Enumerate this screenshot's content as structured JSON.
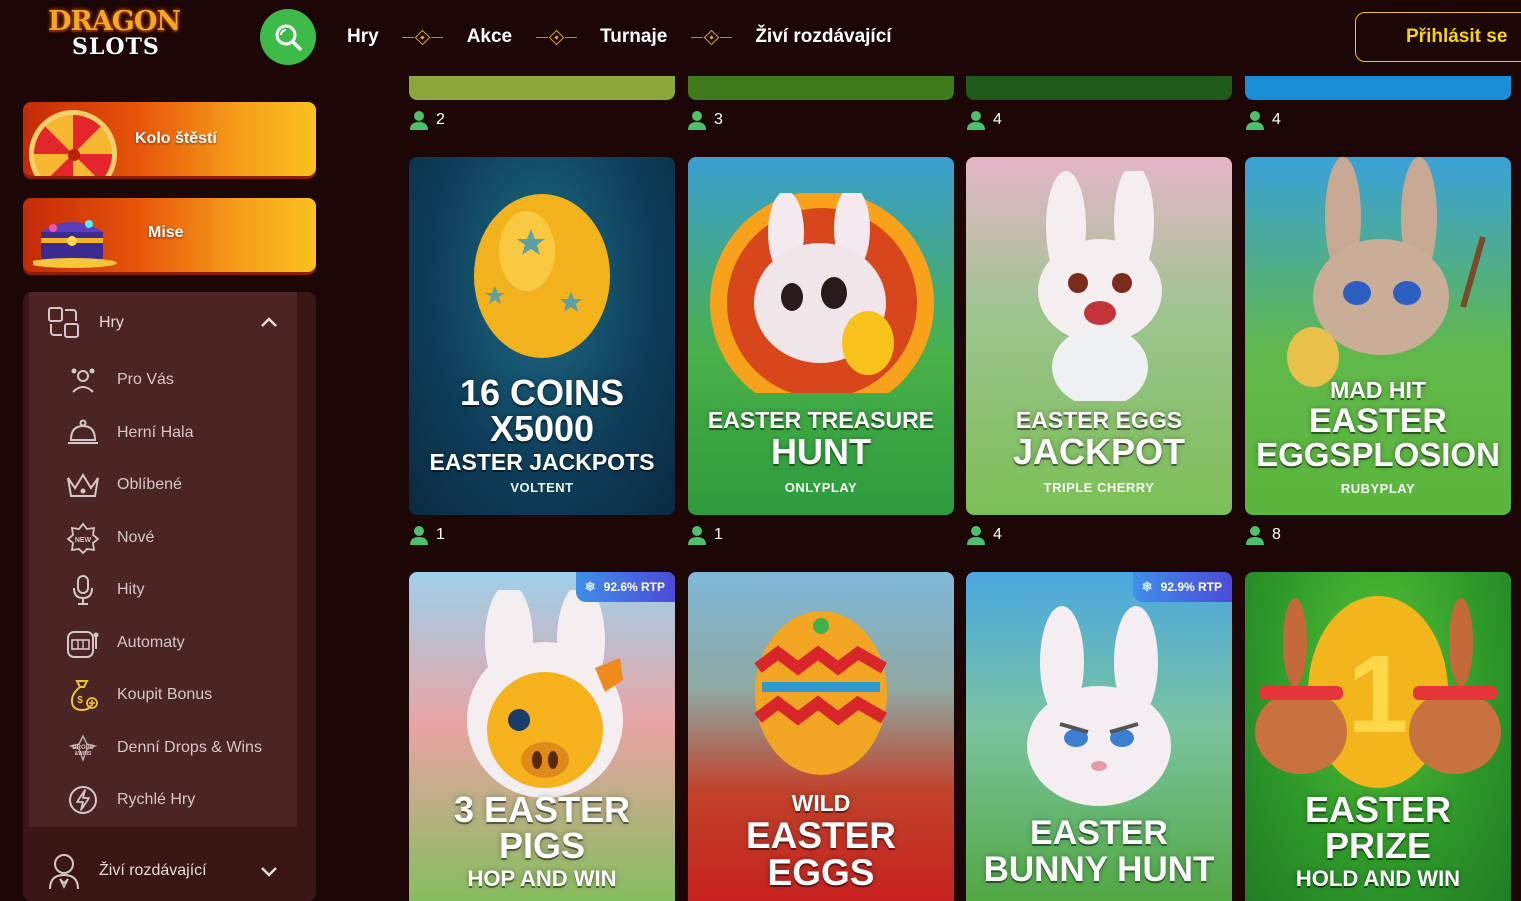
{
  "header": {
    "logo": {
      "line1": "DRAGON",
      "line2": "SLOTS"
    },
    "nav": [
      "Hry",
      "Akce",
      "Turnaje",
      "Živí rozdávající"
    ],
    "login_label": "Přihlásit se"
  },
  "sidebar": {
    "promos": [
      {
        "label": "Kolo štěstí"
      },
      {
        "label": "Mise"
      }
    ],
    "games_header": "Hry",
    "items": [
      {
        "label": "Pro Vás",
        "icon": "tools-icon"
      },
      {
        "label": "Herní Hala",
        "icon": "bell-icon"
      },
      {
        "label": "Oblíbené",
        "icon": "crown-icon"
      },
      {
        "label": "Nové",
        "icon": "new-badge-icon"
      },
      {
        "label": "Hity",
        "icon": "microphone-icon"
      },
      {
        "label": "Automaty",
        "icon": "slot-machine-icon"
      },
      {
        "label": "Koupit Bonus",
        "icon": "money-bag-icon"
      },
      {
        "label": "Denní Drops & Wins",
        "icon": "drops-wins-icon"
      },
      {
        "label": "Rychlé Hry",
        "icon": "lightning-icon"
      }
    ],
    "live_header": "Živí rozdávající"
  },
  "top_row_players": [
    "2",
    "3",
    "4",
    "4"
  ],
  "top_row_colors": [
    "#8ba63a",
    "#3f7a1a",
    "#1f5a1a",
    "#1a8fd8"
  ],
  "games_row1": [
    {
      "title_lines": [
        "16 COINS",
        "X5000"
      ],
      "subtitle": "EASTER JACKPOTS",
      "provider": "VOLTENT",
      "players": "1"
    },
    {
      "title_lines": [
        "EASTER TREASURE",
        "HUNT"
      ],
      "provider": "ONLYPLAY",
      "players": "1"
    },
    {
      "title_lines": [
        "EASTER EGGS",
        "JACKPOT"
      ],
      "provider": "TRIPLE CHERRY",
      "players": "4"
    },
    {
      "title_lines": [
        "MAD HIT",
        "EASTER",
        "EGGSPLOSION"
      ],
      "provider": "RUBYPLAY",
      "players": "8"
    }
  ],
  "games_row2": [
    {
      "title_lines": [
        "3 EASTER",
        "PIGS"
      ],
      "subtitle": "HOP AND WIN",
      "rtp": "92.6% RTP"
    },
    {
      "title_lines": [
        "WILD",
        "EASTER",
        "EGGS"
      ]
    },
    {
      "title_lines": [
        "EASTER",
        "BUNNY HUNT"
      ],
      "rtp": "92.9% RTP"
    },
    {
      "title_lines": [
        "EASTER",
        "PRIZE"
      ],
      "subtitle": "HOLD AND WIN"
    }
  ],
  "colors": {
    "background": "#1d0606",
    "accent_green": "#3dba48",
    "login_yellow": "#f1c21b"
  }
}
